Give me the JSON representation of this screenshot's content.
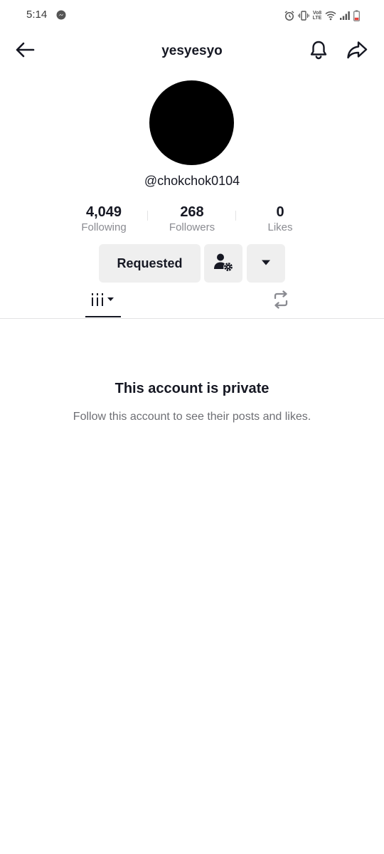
{
  "status_bar": {
    "time": "5:14",
    "icons": [
      "messenger-icon",
      "alarm-icon",
      "vibrate-icon",
      "volte-icon",
      "wifi-icon",
      "signal-icon",
      "battery-low-icon"
    ],
    "volte_text": "Vo8 LTE"
  },
  "header": {
    "title": "yesyesyo",
    "back_icon": "arrow-left-icon",
    "bell_icon": "bell-icon",
    "share_icon": "share-arrow-icon"
  },
  "profile": {
    "handle": "@chokchok0104",
    "stats": [
      {
        "value": "4,049",
        "label": "Following"
      },
      {
        "value": "268",
        "label": "Followers"
      },
      {
        "value": "0",
        "label": "Likes"
      }
    ],
    "buttons": {
      "requested_label": "Requested",
      "friend_icon": "user-settings-icon",
      "more_icon": "caret-down-icon"
    }
  },
  "tabs": {
    "videos_icon": "grid-bars-icon",
    "reposts_icon": "repost-icon"
  },
  "private_notice": {
    "title": "This account is private",
    "description": "Follow this account to see their posts and likes."
  },
  "colors": {
    "text_primary": "#161823",
    "text_secondary": "#8a8b91",
    "button_bg": "#efefef",
    "battery_low": "#e8403a"
  }
}
